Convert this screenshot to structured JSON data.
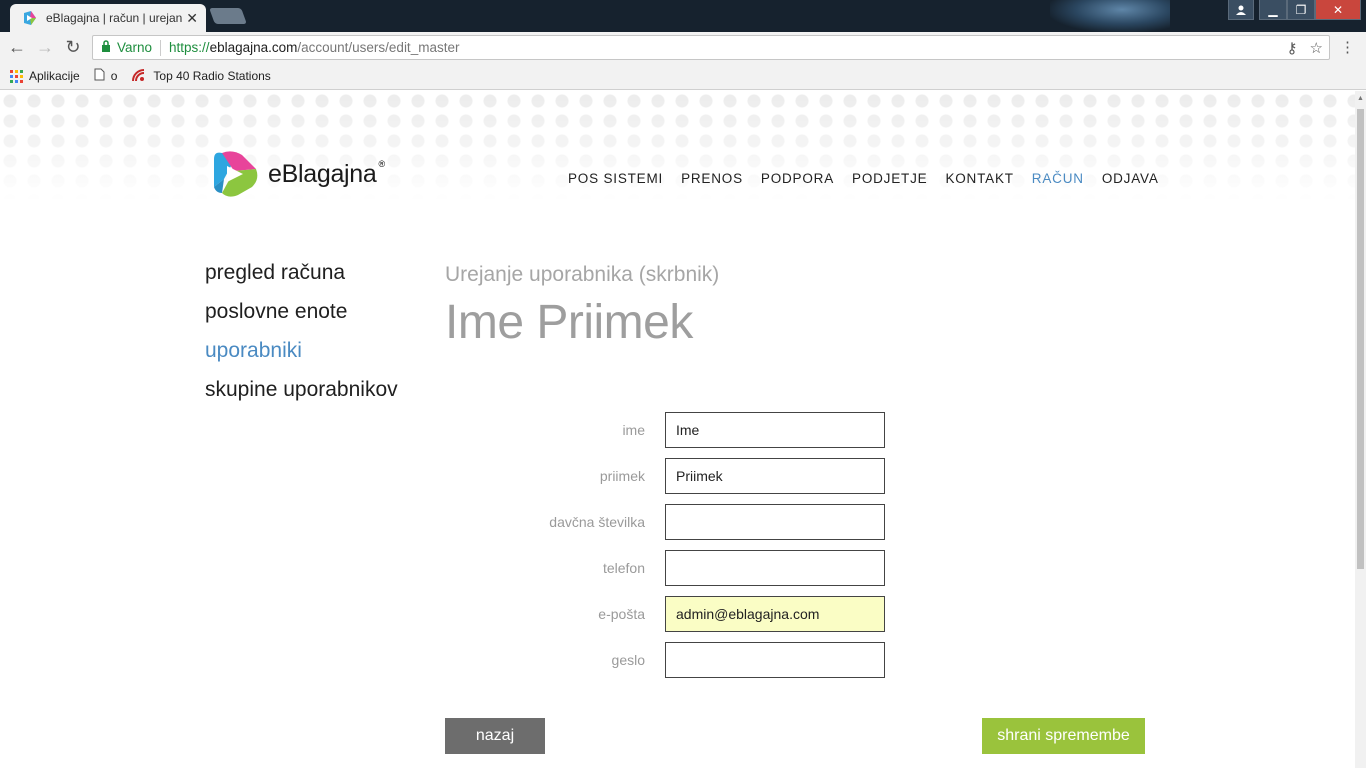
{
  "browser": {
    "tab_title": "eBlagajna | račun | urejan",
    "security_label": "Varno",
    "url_protocol": "https://",
    "url_host": "eblagajna.com",
    "url_path": "/account/users/edit_master",
    "bookmarks": [
      {
        "label": "Aplikacije",
        "icon": "apps-grid-icon"
      },
      {
        "label": "o",
        "icon": "page-icon"
      },
      {
        "label": "Top 40 Radio Stations",
        "icon": "radio-icon"
      }
    ]
  },
  "site": {
    "logo_text": "eBlagajna",
    "logo_reg": "®",
    "nav": [
      {
        "label": "POS SISTEMI",
        "active": false
      },
      {
        "label": "PRENOS",
        "active": false
      },
      {
        "label": "PODPORA",
        "active": false
      },
      {
        "label": "PODJETJE",
        "active": false
      },
      {
        "label": "KONTAKT",
        "active": false
      },
      {
        "label": "RAČUN",
        "active": true
      },
      {
        "label": "ODJAVA",
        "active": false
      }
    ],
    "accent_color": "#4a8ac2"
  },
  "sidebar": {
    "items": [
      {
        "label": "pregled računa",
        "active": false
      },
      {
        "label": "poslovne enote",
        "active": false
      },
      {
        "label": "uporabniki",
        "active": true
      },
      {
        "label": "skupine uporabnikov",
        "active": false
      }
    ]
  },
  "main": {
    "subtitle": "Urejanje uporabnika (skrbnik)",
    "title": "Ime Priimek",
    "fields": [
      {
        "label": "ime",
        "value": "Ime"
      },
      {
        "label": "priimek",
        "value": "Priimek"
      },
      {
        "label": "davčna številka",
        "value": ""
      },
      {
        "label": "telefon",
        "value": ""
      },
      {
        "label": "e-pošta",
        "value": "admin@eblagajna.com"
      },
      {
        "label": "geslo",
        "value": ""
      }
    ],
    "back_label": "nazaj",
    "save_label": "shrani spremembe",
    "save_color": "#9ac33c",
    "autofill_color": "#fafdc5"
  }
}
